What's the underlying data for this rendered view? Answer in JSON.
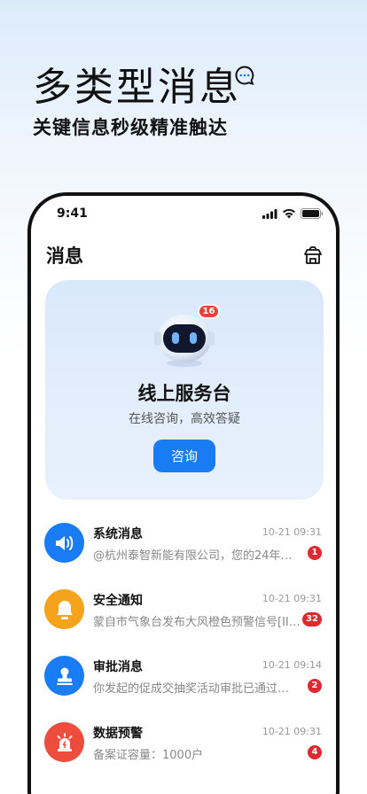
{
  "hero": {
    "title": "多类型消息",
    "subtitle": "关键信息秒级精准触达"
  },
  "status_bar": {
    "time": "9:41"
  },
  "page": {
    "title": "消息"
  },
  "service_card": {
    "badge": "16",
    "title": "线上服务台",
    "subtitle": "在线咨询，高效答疑",
    "button_label": "咨询"
  },
  "messages": [
    {
      "title": "系统消息",
      "time": "10-21 09:31",
      "preview": "@杭州泰智新能有限公司，您的24年年…",
      "badge": "1",
      "color": "#1a7cf4",
      "icon": "speaker-icon"
    },
    {
      "title": "安全通知",
      "time": "10-21 09:31",
      "preview": "蒙自市气象台发布大风橙色预警信号[II…",
      "badge": "32",
      "color": "#f7a21b",
      "icon": "bell-icon"
    },
    {
      "title": "审批消息",
      "time": "10-21 09:14",
      "preview": "你发起的促成交抽奖活动审批已通过…",
      "badge": "2",
      "color": "#1a7cf4",
      "icon": "stamp-icon"
    },
    {
      "title": "数据预警",
      "time": "10-21 09:31",
      "preview": "备案证容量：1000户",
      "badge": "4",
      "color": "#ee4d3d",
      "icon": "alarm-icon"
    }
  ]
}
